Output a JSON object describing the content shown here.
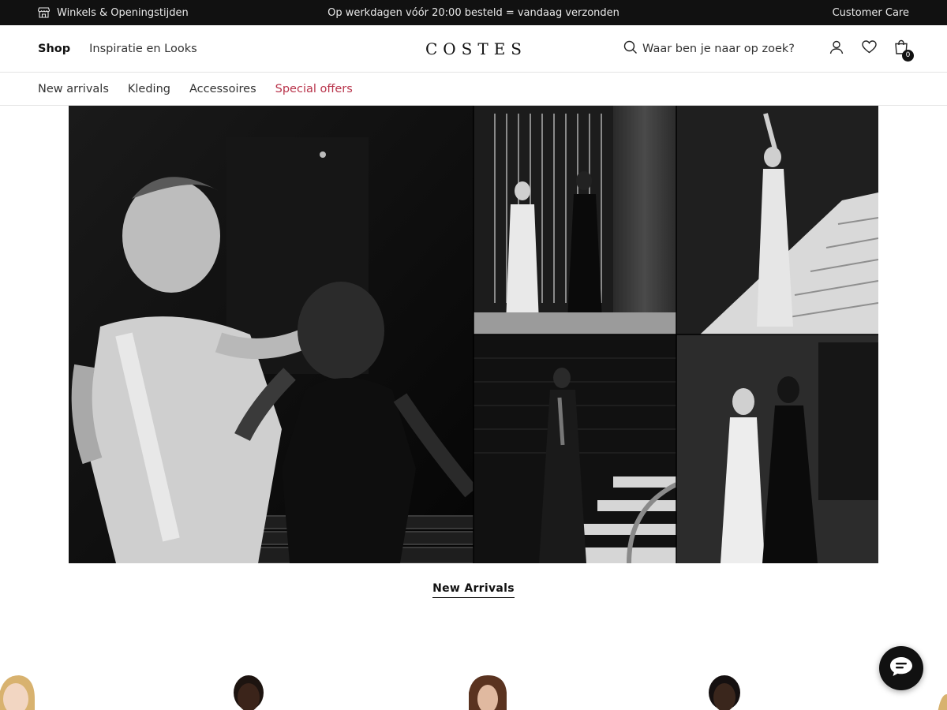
{
  "topbar": {
    "stores_label": "Winkels & Openingstijden",
    "promo_text": "Op werkdagen vóór 20:00 besteld = vandaag verzonden",
    "customer_care_label": "Customer Care",
    "background": "#111111"
  },
  "header": {
    "logo": "COSTES",
    "nav": [
      {
        "label": "Shop"
      },
      {
        "label": "Inspiratie en Looks"
      }
    ],
    "search": {
      "placeholder": "Waar ben je naar op zoek?",
      "icon": "search-icon"
    },
    "account_icon": "user-icon",
    "wishlist_icon": "heart-icon",
    "cart": {
      "icon": "shopping-bag-icon",
      "count": "0"
    }
  },
  "categories": [
    {
      "label": "New arrivals"
    },
    {
      "label": "Kleding"
    },
    {
      "label": "Accessoires"
    },
    {
      "label": "Special offers",
      "color": "#b8334a"
    }
  ],
  "hero": {
    "style": "black-and-white editorial photo collage",
    "panels": 5
  },
  "section": {
    "title": "New Arrivals"
  },
  "chat": {
    "icon": "chat-bubble-icon"
  }
}
